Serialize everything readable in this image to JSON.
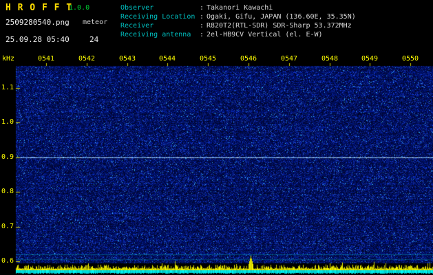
{
  "header": {
    "app_name": "H R O F F T",
    "version": "1.0.0",
    "filename": "2509280540.png",
    "mode": "meteor",
    "datetime": "25.09.28 05:40",
    "count": "24",
    "separator": ":",
    "info": [
      {
        "label": "Observer",
        "value": "Takanori Kawachi"
      },
      {
        "label": "Receiving Location",
        "value": "Ogaki, Gifu, JAPAN (136.60E, 35.35N)"
      },
      {
        "label": "Receiver",
        "value": "R820T2(RTL-SDR) SDR-Sharp 53.372MHz"
      },
      {
        "label": "Receiving antenna",
        "value": "2el-HB9CV Vertical (el. E-W)"
      }
    ]
  },
  "chart_data": {
    "type": "heatmap",
    "description": "radio meteor observation spectrogram, dark blue noise background",
    "ylabel": "kHz",
    "x_ticks": [
      "0541",
      "0542",
      "0543",
      "0544",
      "0545",
      "0546",
      "0547",
      "0548",
      "0549",
      "0550"
    ],
    "y_ticks": [
      "1.1",
      "1.0",
      "0.9",
      "0.8",
      "0.7",
      "0.6"
    ],
    "y_range_khz": [
      0.58,
      1.17
    ],
    "grid": false,
    "legend": "none",
    "features": {
      "carrier_line_khz": 0.9,
      "faint_lines_khz": [
        0.62,
        0.61
      ],
      "noise_level_trace": "yellow spiky trace along bottom",
      "noise_level_trace_spike_at": "0546",
      "bottom_band": "solid cyan signal-level band at bottom edge"
    }
  },
  "colors": {
    "background": "#000000",
    "axis_text": "#ffff00",
    "title": "#ffdd00",
    "version": "#00cc33",
    "info_label": "#00c0c0",
    "info_value": "#d8d8d8",
    "noise_base": "#000a46",
    "carrier_line": "#9fd8ff",
    "trace": "#ffff00",
    "band": "#00e0e0",
    "tick": "#cccc00"
  }
}
